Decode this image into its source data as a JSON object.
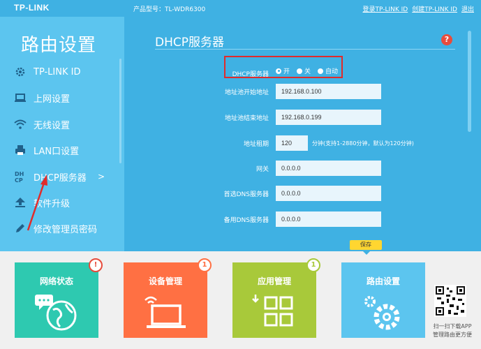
{
  "topbar": {
    "logo": "TP-LINK",
    "model": "产品型号：TL-WDR6300",
    "links": [
      "登录TP-LINK ID",
      "创建TP-LINK ID",
      "退出"
    ]
  },
  "sidebar": {
    "title": "路由设置",
    "items": [
      {
        "label": "TP-LINK ID",
        "icon": "gear-icon"
      },
      {
        "label": "上网设置",
        "icon": "laptop-icon"
      },
      {
        "label": "无线设置",
        "icon": "wifi-icon"
      },
      {
        "label": "LAN口设置",
        "icon": "printer-icon"
      },
      {
        "label": "DHCP服务器",
        "icon": "dhcp-icon",
        "chevron": ">"
      },
      {
        "label": "软件升级",
        "icon": "upload-icon"
      },
      {
        "label": "修改管理员密码",
        "icon": "pencil-icon"
      }
    ]
  },
  "main": {
    "title": "DHCP服务器",
    "help": "?",
    "dhcp_label": "DHCP服务器",
    "radio_options": [
      "开",
      "关",
      "自动"
    ],
    "radio_selected": "开",
    "fields": [
      {
        "label": "地址池开始地址",
        "value": "192.168.0.100"
      },
      {
        "label": "地址池结束地址",
        "value": "192.168.0.199"
      },
      {
        "label": "地址租期",
        "value": "120",
        "hint": "分钟(支持1-2880分钟，默认为120分钟)"
      },
      {
        "label": "网关",
        "value": "0.0.0.0"
      },
      {
        "label": "首选DNS服务器",
        "value": "0.0.0.0"
      },
      {
        "label": "备用DNS服务器",
        "value": "0.0.0.0"
      }
    ],
    "save_label": "保存"
  },
  "tiles": [
    {
      "label": "网络状态",
      "color": "#2ec9b0",
      "badge": "!",
      "badge_color": "#e74c3c",
      "icon": "globe-chat-icon"
    },
    {
      "label": "设备管理",
      "color": "#ff7043",
      "badge": "1",
      "badge_color": "#ff7043",
      "icon": "laptop-wifi-icon"
    },
    {
      "label": "应用管理",
      "color": "#a8c93a",
      "badge": "1",
      "badge_color": "#a8c93a",
      "icon": "apps-grid-icon"
    },
    {
      "label": "路由设置",
      "color": "#5cc5ef",
      "icon": "gears-icon"
    }
  ],
  "qr_text": [
    "扫一扫下载APP",
    "管理路由更方便"
  ]
}
